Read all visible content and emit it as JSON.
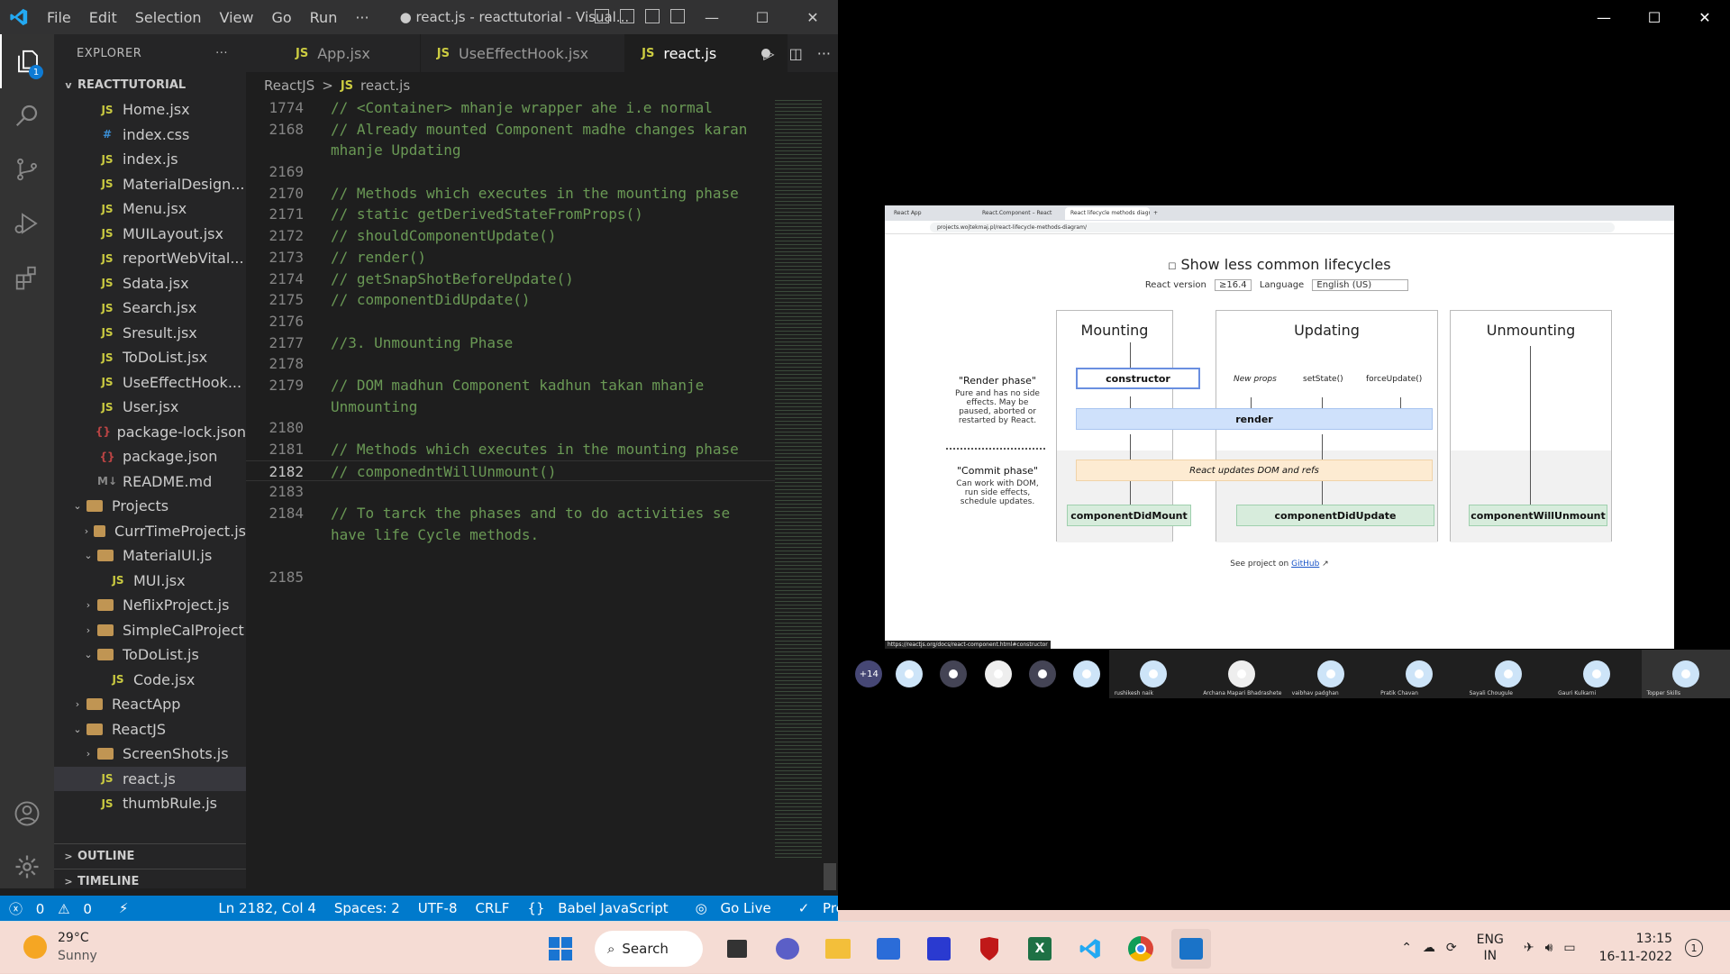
{
  "vscode": {
    "menu": [
      "File",
      "Edit",
      "Selection",
      "View",
      "Go",
      "Run",
      "···"
    ],
    "window_title": "● react.js - reacttutorial - Visual...",
    "explorer_label": "EXPLORER",
    "project": "REACTTUTORIAL",
    "tree": [
      {
        "label": "Home.jsx",
        "icon": "js",
        "indent": 2
      },
      {
        "label": "index.css",
        "icon": "css",
        "indent": 2
      },
      {
        "label": "index.js",
        "icon": "js",
        "indent": 2
      },
      {
        "label": "MaterialDesign...",
        "icon": "js",
        "indent": 2
      },
      {
        "label": "Menu.jsx",
        "icon": "js",
        "indent": 2
      },
      {
        "label": "MUILayout.jsx",
        "icon": "js",
        "indent": 2
      },
      {
        "label": "reportWebVital...",
        "icon": "js",
        "indent": 2
      },
      {
        "label": "Sdata.jsx",
        "icon": "js",
        "indent": 2
      },
      {
        "label": "Search.jsx",
        "icon": "js",
        "indent": 2
      },
      {
        "label": "Sresult.jsx",
        "icon": "js",
        "indent": 2
      },
      {
        "label": "ToDoList.jsx",
        "icon": "js",
        "indent": 2
      },
      {
        "label": "UseEffectHook...",
        "icon": "js",
        "indent": 2
      },
      {
        "label": "User.jsx",
        "icon": "js",
        "indent": 2
      },
      {
        "label": "package-lock.json",
        "icon": "json",
        "indent": 2
      },
      {
        "label": "package.json",
        "icon": "json",
        "indent": 2
      },
      {
        "label": "README.md",
        "icon": "md",
        "indent": 2
      },
      {
        "label": "Projects",
        "icon": "folder",
        "indent": 1,
        "chev": "v"
      },
      {
        "label": "CurrTimeProject.js",
        "icon": "folder",
        "indent": 2,
        "chev": ">"
      },
      {
        "label": "MaterialUI.js",
        "icon": "folder",
        "indent": 2,
        "chev": "v"
      },
      {
        "label": "MUI.jsx",
        "icon": "js",
        "indent": 3
      },
      {
        "label": "NeflixProject.js",
        "icon": "folder",
        "indent": 2,
        "chev": ">"
      },
      {
        "label": "SimpleCalProject",
        "icon": "folder",
        "indent": 2,
        "chev": ">"
      },
      {
        "label": "ToDoList.js",
        "icon": "folder",
        "indent": 2,
        "chev": "v"
      },
      {
        "label": "Code.jsx",
        "icon": "js",
        "indent": 3
      },
      {
        "label": "ReactApp",
        "icon": "folder",
        "indent": 1,
        "chev": ">"
      },
      {
        "label": "ReactJS",
        "icon": "folder",
        "indent": 1,
        "chev": "v"
      },
      {
        "label": "ScreenShots.js",
        "icon": "folder",
        "indent": 2,
        "chev": ">"
      },
      {
        "label": "react.js",
        "icon": "js",
        "indent": 2,
        "selected": true
      },
      {
        "label": "thumbRule.js",
        "icon": "js",
        "indent": 2
      }
    ],
    "outline": "OUTLINE",
    "timeline": "TIMELINE",
    "tabs": [
      {
        "label": "App.jsx",
        "active": false
      },
      {
        "label": "UseEffectHook.jsx",
        "active": false
      },
      {
        "label": "react.js",
        "active": true
      }
    ],
    "breadcrumb": [
      "ReactJS",
      ">",
      "react.js"
    ],
    "code_lines": [
      {
        "n": "1774",
        "t": "// <Container> mhanje wrapper ahe i.e normal"
      },
      {
        "n": "2168",
        "t": "// Already mounted Component madhe changes karan"
      },
      {
        "n": "",
        "t": "mhanje Updating"
      },
      {
        "n": "2169",
        "t": ""
      },
      {
        "n": "2170",
        "t": "// Methods which executes in the mounting phase"
      },
      {
        "n": "2171",
        "t": "// static getDerivedStateFromProps()"
      },
      {
        "n": "2172",
        "t": "// shouldComponentUpdate()"
      },
      {
        "n": "2173",
        "t": "// render()"
      },
      {
        "n": "2174",
        "t": "// getSnapShotBeforeUpdate()"
      },
      {
        "n": "2175",
        "t": "// componentDidUpdate()"
      },
      {
        "n": "2176",
        "t": ""
      },
      {
        "n": "2177",
        "t": "//3. Unmounting Phase"
      },
      {
        "n": "2178",
        "t": ""
      },
      {
        "n": "2179",
        "t": "// DOM madhun Component kadhun takan mhanje"
      },
      {
        "n": "",
        "t": "Unmounting"
      },
      {
        "n": "2180",
        "t": ""
      },
      {
        "n": "2181",
        "t": "// Methods which executes in the mounting phase"
      },
      {
        "n": "2182",
        "t": "// componedntWillUnmount()",
        "current": true
      },
      {
        "n": "2183",
        "t": ""
      },
      {
        "n": "2184",
        "t": "// To tarck the phases and to do activities se"
      },
      {
        "n": "",
        "t": "have life Cycle methods."
      },
      {
        "n": "",
        "t": ""
      },
      {
        "n": "2185",
        "t": ""
      }
    ],
    "status": {
      "errors": "0",
      "warnings": "0",
      "position": "Ln 2182, Col 4",
      "spaces": "Spaces: 2",
      "encoding": "UTF-8",
      "eol": "CRLF",
      "language": "Babel JavaScript",
      "golive": "Go Live",
      "prettier": "Prettier"
    }
  },
  "meeting": {
    "browser_tabs": [
      "React App",
      "React.Component – React",
      "React lifecycle methods diagr..."
    ],
    "url": "projects.wojtekmaj.pl/react-lifecycle-methods-diagram/",
    "show_less": "Show less common lifecycles",
    "react_version_label": "React version",
    "react_version": "≥16.4",
    "language_label": "Language",
    "language": "English (US)",
    "phases": [
      "Mounting",
      "Updating",
      "Unmounting"
    ],
    "render_phase_title": "\"Render phase\"",
    "render_phase_desc": "Pure and has no side effects. May be paused, aborted or restarted by React.",
    "commit_phase_title": "\"Commit phase\"",
    "commit_phase_desc": "Can work with DOM, run side effects, schedule updates.",
    "constructor": "constructor",
    "new_props": "New props",
    "set_state": "setState()",
    "force_update": "forceUpdate()",
    "render": "render",
    "react_updates": "React updates DOM and refs",
    "did_mount": "componentDidMount",
    "did_update": "componentDidUpdate",
    "will_unmount": "componentWillUnmount",
    "github_prefix": "See project on",
    "github": "GitHub",
    "hover_url": "https://reactjs.org/docs/react-component.html#constructor",
    "more_count": "+14",
    "participants": [
      "",
      "",
      "",
      "",
      "",
      "rushikesh naik",
      "Archana Mapari Bhadrashete",
      "vaibhav padghan",
      "Pratik Chavan",
      "Sayali Chougule",
      "Gauri Kulkarni",
      "Topper Skills"
    ]
  },
  "taskbar": {
    "temp": "29°C",
    "condition": "Sunny",
    "search": "Search",
    "lang1": "ENG",
    "lang2": "IN",
    "time": "13:15",
    "date": "16-11-2022",
    "notif": "1"
  }
}
